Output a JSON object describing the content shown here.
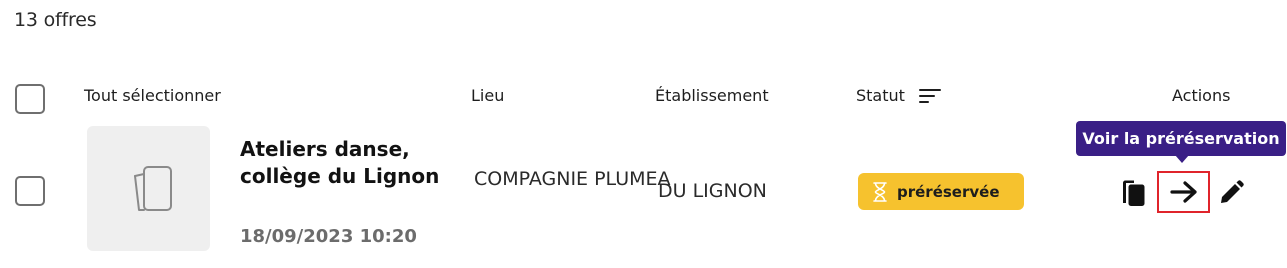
{
  "summary": {
    "count_text": "13 offres"
  },
  "table": {
    "headers": {
      "select_all": "Tout sélectionner",
      "lieu": "Lieu",
      "etablissement": "Établissement",
      "statut": "Statut",
      "actions": "Actions"
    },
    "rows": [
      {
        "title": "Ateliers danse, collège du Lignon",
        "date": "18/09/2023 10:20",
        "lieu": "COMPAGNIE PLUMEA",
        "etablissement": "DU LIGNON",
        "status": {
          "label": "préréservée",
          "icon": "hourglass-icon",
          "color": "#f6c22e"
        },
        "actions": [
          "duplicate-icon",
          "arrow-right-icon",
          "pencil-icon"
        ]
      }
    ]
  },
  "tooltip": {
    "text": "Voir la préréservation",
    "color": "#3a1f86"
  },
  "colors": {
    "highlight_border": "#e0242b",
    "checkbox_border": "#6f6f6f"
  }
}
